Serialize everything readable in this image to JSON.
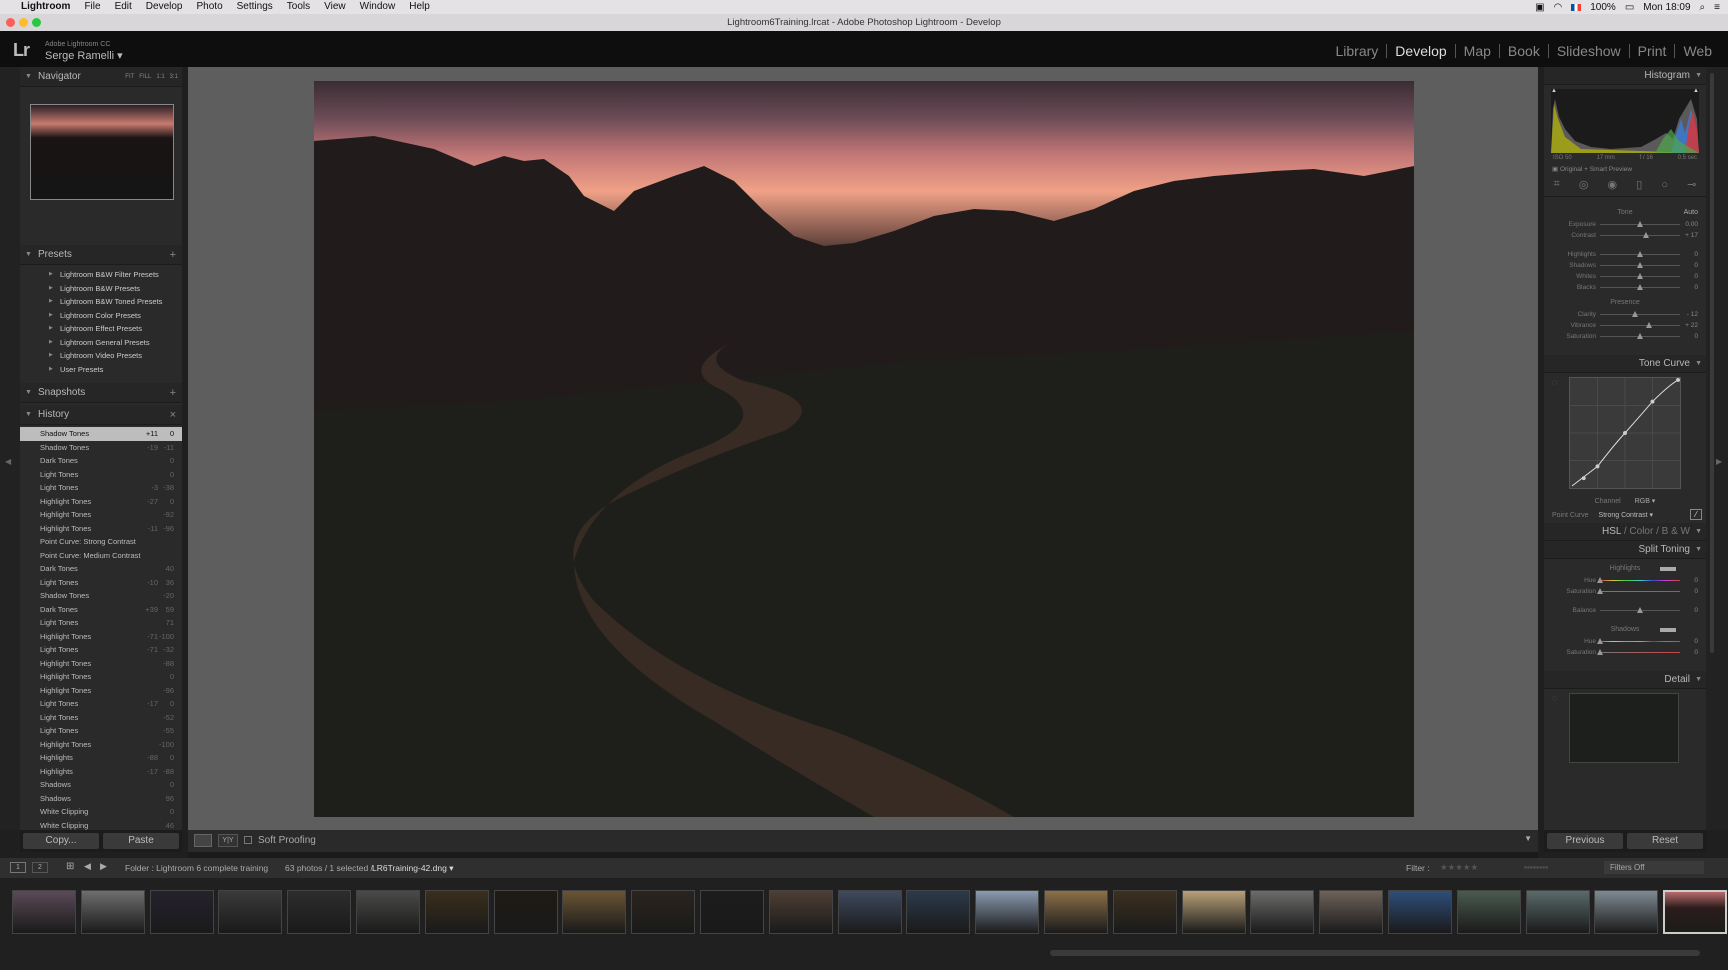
{
  "menubar": {
    "app": "Lightroom",
    "items": [
      "File",
      "Edit",
      "Develop",
      "Photo",
      "Settings",
      "Tools",
      "View",
      "Window",
      "Help"
    ],
    "battery": "100%",
    "clock": "Mon 18:09"
  },
  "window": {
    "title": "Lightroom6Training.lrcat - Adobe Photoshop Lightroom - Develop"
  },
  "identity": {
    "logo": "Lr",
    "product": "Adobe Lightroom CC",
    "user": "Serge Ramelli"
  },
  "modules": [
    "Library",
    "Develop",
    "Map",
    "Book",
    "Slideshow",
    "Print",
    "Web"
  ],
  "active_module": "Develop",
  "navigator": {
    "title": "Navigator",
    "zoom": [
      "FIT",
      "FILL",
      "1:1",
      "3:1"
    ]
  },
  "presets": {
    "title": "Presets",
    "items": [
      "Lightroom B&W Filter Presets",
      "Lightroom B&W Presets",
      "Lightroom B&W Toned Presets",
      "Lightroom Color Presets",
      "Lightroom Effect Presets",
      "Lightroom General Presets",
      "Lightroom Video Presets",
      "User Presets"
    ]
  },
  "snapshots": {
    "title": "Snapshots"
  },
  "history": {
    "title": "History",
    "items": [
      {
        "n": "Shadow Tones",
        "a": "+11",
        "b": "0"
      },
      {
        "n": "Shadow Tones",
        "a": "-19",
        "b": "-11"
      },
      {
        "n": "Dark Tones",
        "a": "",
        "b": "0"
      },
      {
        "n": "Light Tones",
        "a": "",
        "b": "0"
      },
      {
        "n": "Light Tones",
        "a": "-3",
        "b": "-38"
      },
      {
        "n": "Highlight Tones",
        "a": "-27",
        "b": "0"
      },
      {
        "n": "Highlight Tones",
        "a": "",
        "b": "-92"
      },
      {
        "n": "Highlight Tones",
        "a": "-11",
        "b": "-96"
      },
      {
        "n": "Point Curve: Strong Contrast",
        "a": "",
        "b": ""
      },
      {
        "n": "Point Curve: Medium Contrast",
        "a": "",
        "b": ""
      },
      {
        "n": "Dark Tones",
        "a": "",
        "b": "40"
      },
      {
        "n": "Light Tones",
        "a": "-10",
        "b": "36"
      },
      {
        "n": "Shadow Tones",
        "a": "",
        "b": "-20"
      },
      {
        "n": "Dark Tones",
        "a": "+39",
        "b": "59"
      },
      {
        "n": "Light Tones",
        "a": "",
        "b": "71"
      },
      {
        "n": "Highlight Tones",
        "a": "-71",
        "b": "-100"
      },
      {
        "n": "Light Tones",
        "a": "-71",
        "b": "-32"
      },
      {
        "n": "Highlight Tones",
        "a": "",
        "b": "-88"
      },
      {
        "n": "Highlight Tones",
        "a": "",
        "b": "0"
      },
      {
        "n": "Highlight Tones",
        "a": "",
        "b": "-96"
      },
      {
        "n": "Light Tones",
        "a": "-17",
        "b": "0"
      },
      {
        "n": "Light Tones",
        "a": "",
        "b": "-52"
      },
      {
        "n": "Light Tones",
        "a": "",
        "b": "-55"
      },
      {
        "n": "Highlight Tones",
        "a": "",
        "b": "-100"
      },
      {
        "n": "Highlights",
        "a": "-88",
        "b": "0"
      },
      {
        "n": "Highlights",
        "a": "-17",
        "b": "-88"
      },
      {
        "n": "Shadows",
        "a": "",
        "b": "0"
      },
      {
        "n": "Shadows",
        "a": "",
        "b": "96"
      },
      {
        "n": "White Clipping",
        "a": "",
        "b": "0"
      },
      {
        "n": "White Clipping",
        "a": "",
        "b": "46"
      }
    ]
  },
  "buttons": {
    "copy": "Copy...",
    "paste": "Paste",
    "previous": "Previous",
    "reset": "Reset"
  },
  "toolbar": {
    "soft_proofing": "Soft Proofing"
  },
  "histogram": {
    "title": "Histogram",
    "iso": "ISO 50",
    "focal": "17 mm",
    "aperture": "f / 16",
    "shutter": "0.5 sec",
    "preview": "Original + Smart Preview"
  },
  "basic": {
    "tone": "Tone",
    "auto": "Auto",
    "presence": "Presence",
    "sliders": [
      {
        "l": "Exposure",
        "v": "0.00",
        "p": 0.5
      },
      {
        "l": "Contrast",
        "v": "+ 17",
        "p": 0.58
      },
      {
        "l": "Highlights",
        "v": "0",
        "p": 0.5
      },
      {
        "l": "Shadows",
        "v": "0",
        "p": 0.5
      },
      {
        "l": "Whites",
        "v": "0",
        "p": 0.5
      },
      {
        "l": "Blacks",
        "v": "0",
        "p": 0.5
      }
    ],
    "presence_sliders": [
      {
        "l": "Clarity",
        "v": "- 12",
        "p": 0.44
      },
      {
        "l": "Vibrance",
        "v": "+ 22",
        "p": 0.61
      },
      {
        "l": "Saturation",
        "v": "0",
        "p": 0.5
      }
    ]
  },
  "tone_curve": {
    "title": "Tone Curve",
    "channel_label": "Channel",
    "channel": "RGB",
    "point_curve_label": "Point Curve",
    "point_curve": "Strong Contrast"
  },
  "hsl": {
    "hsl": "HSL",
    "color": "Color",
    "bw": "B & W"
  },
  "split_toning": {
    "title": "Split Toning",
    "highlights": "Highlights",
    "shadows": "Shadows",
    "hue": "Hue",
    "saturation": "Saturation",
    "balance": "Balance",
    "values": [
      "0",
      "0",
      "0",
      "0",
      "0"
    ]
  },
  "detail": {
    "title": "Detail"
  },
  "filmbar": {
    "pages": [
      "1",
      "2"
    ],
    "folder": "Folder : Lightroom 6 complete training",
    "count": "63 photos / 1 selected /",
    "file": "LR6Training-42.dng",
    "filter": "Filter :",
    "filters_off": "Filters Off"
  }
}
